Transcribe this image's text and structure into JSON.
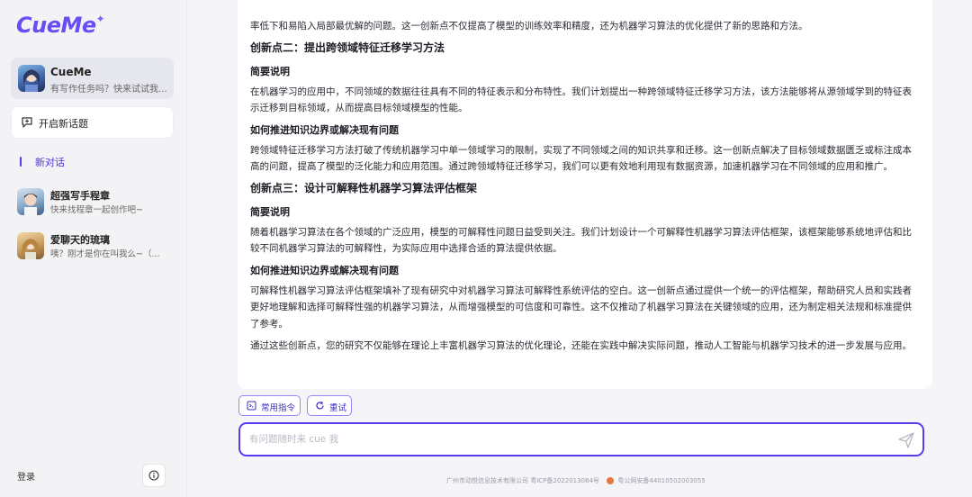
{
  "app": {
    "logo": "CueMe"
  },
  "sidebar": {
    "assistant": {
      "name": "CueMe",
      "subtitle": "有写作任务吗？快来试试我..."
    },
    "new_topic_label": "开启新话题",
    "new_chat_label": "新对话",
    "agents": [
      {
        "name": "超强写手程章",
        "subtitle": "快来找程章一起创作吧~"
      },
      {
        "name": "爱聊天的琉璃",
        "subtitle": "咦？刚才是你在叫我么~（..."
      }
    ],
    "login_label": "登录"
  },
  "message": {
    "p0": "率低下和易陷入局部最优解的问题。这一创新点不仅提高了模型的训练效率和精度，还为机器学习算法的优化提供了新的思路和方法。",
    "h2": "创新点二：提出跨领域特征迁移学习方法",
    "h2_sub1": "简要说明",
    "p2_1": "在机器学习的应用中，不同领域的数据往往具有不同的特征表示和分布特性。我们计划提出一种跨领域特征迁移学习方法，该方法能够将从源领域学到的特征表示迁移到目标领域，从而提高目标领域模型的性能。",
    "h2_sub2": "如何推进知识边界或解决现有问题",
    "p2_2": "跨领域特征迁移学习方法打破了传统机器学习中单一领域学习的限制，实现了不同领域之间的知识共享和迁移。这一创新点解决了目标领域数据匮乏或标注成本高的问题，提高了模型的泛化能力和应用范围。通过跨领域特征迁移学习，我们可以更有效地利用现有数据资源，加速机器学习在不同领域的应用和推广。",
    "h3": "创新点三：设计可解释性机器学习算法评估框架",
    "h3_sub1": "简要说明",
    "p3_1": "随着机器学习算法在各个领域的广泛应用，模型的可解释性问题日益受到关注。我们计划设计一个可解释性机器学习算法评估框架，该框架能够系统地评估和比较不同机器学习算法的可解释性，为实际应用中选择合适的算法提供依据。",
    "h3_sub2": "如何推进知识边界或解决现有问题",
    "p3_2": "可解释性机器学习算法评估框架填补了现有研究中对机器学习算法可解释性系统评估的空白。这一创新点通过提供一个统一的评估框架，帮助研究人员和实践者更好地理解和选择可解释性强的机器学习算法，从而增强模型的可信度和可靠性。这不仅推动了机器学习算法在关键领域的应用，还为制定相关法规和标准提供了参考。",
    "p_final": "通过这些创新点，您的研究不仅能够在理论上丰富机器学习算法的优化理论，还能在实践中解决实际问题，推动人工智能与机器学习技术的进一步发展与应用。"
  },
  "actions": {
    "common_cmd_label": "常用指令",
    "retry_label": "重试"
  },
  "input": {
    "placeholder": "有问题随时来 cue 我",
    "value": ""
  },
  "footer": {
    "company": "广州市动悦信息技术有限公司 粤ICP备2022013084号",
    "police": "粤公网安备44010502003055"
  },
  "colors": {
    "accent": "#5a3cf0",
    "sidebar_bg": "#f3f3f6"
  }
}
